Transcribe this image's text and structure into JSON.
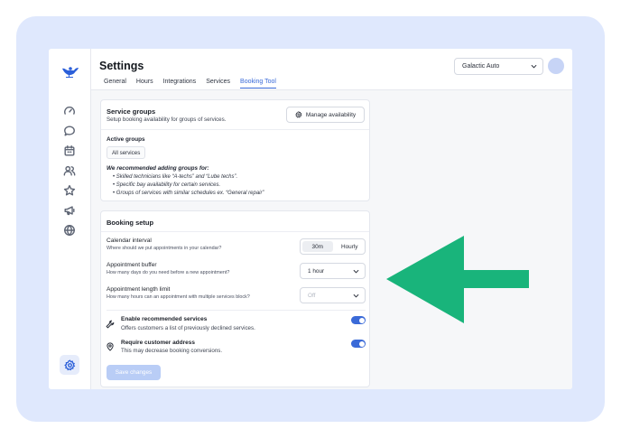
{
  "header": {
    "title": "Settings",
    "tabs": [
      "General",
      "Hours",
      "Integrations",
      "Services",
      "Booking Tool"
    ],
    "active_tab": "Booking Tool",
    "location": "Galactic Auto"
  },
  "sidebar": {
    "icons": [
      "speedometer-icon",
      "chat-icon",
      "calendar-icon",
      "users-icon",
      "star-icon",
      "megaphone-icon",
      "globe-icon"
    ],
    "bottom_icon": "gear-icon"
  },
  "service_groups": {
    "title": "Service groups",
    "subtitle": "Setup booking availability for groups of services.",
    "manage_button": "Manage availability",
    "active_groups_label": "Active groups",
    "active_group_chip": "All services",
    "recommend_title": "We recommended adding groups for:",
    "recommendations": [
      "Skilled technicians like “A-techs” and “Lube techs”.",
      "Specific bay availability for certain services.",
      "Groups of services with similar schedules ex. “General repair”"
    ]
  },
  "booking_setup": {
    "title": "Booking setup",
    "calendar_interval": {
      "label": "Calendar interval",
      "help": "Where should we put appointments in your calendar?",
      "options": [
        "30m",
        "Hourly"
      ],
      "selected": "30m"
    },
    "appointment_buffer": {
      "label": "Appointment buffer",
      "help": "How many days do you need before a new appointment?",
      "value": "1 hour"
    },
    "appointment_length": {
      "label": "Appointment length limit",
      "help": "How many hours can an appointment with multiple services block?",
      "value": "Off"
    },
    "recommended_services": {
      "label": "Enable recommended services",
      "help": "Offers customers a list of previously declined services.",
      "enabled": true
    },
    "customer_address": {
      "label": "Require customer address",
      "help": "This may decrease booking conversions.",
      "enabled": true
    },
    "save_button": "Save changes"
  },
  "colors": {
    "accent": "#3a6ad8",
    "arrow": "#19b47b",
    "frame": "#dfe8fd"
  }
}
